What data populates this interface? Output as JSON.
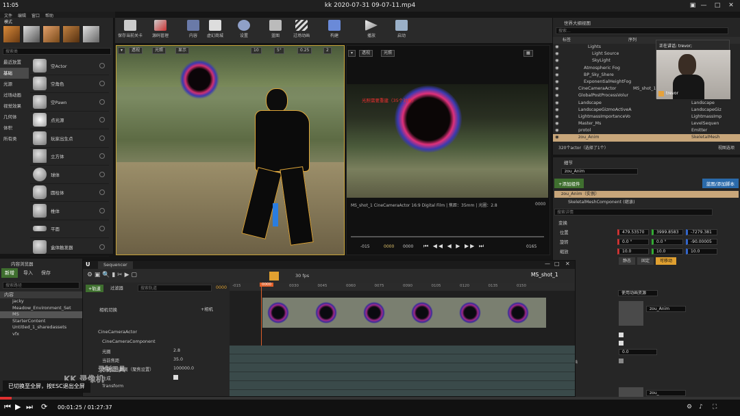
{
  "player": {
    "clock": "11:05",
    "video_title": "kk 2020-07-31 09-07-11.mp4",
    "time_current": "00:01:25",
    "time_separator": " / ",
    "time_total": "01:27:37",
    "progress_fraction": 0.016,
    "fullscreen_tip": "已切换至全屏，按ESC退出全屏"
  },
  "menu": [
    "文件",
    "编辑",
    "窗口",
    "帮助"
  ],
  "modes": {
    "title": "模式",
    "search_placeholder": "搜索类",
    "categories": [
      "最近放置",
      "基础",
      "光源",
      "过场动画",
      "视觉效果",
      "几何体",
      "体积",
      "所有类"
    ],
    "active_category": 1,
    "items": [
      "空Actor",
      "空角色",
      "空Pawn",
      "点光源",
      "玩家出生点",
      "立方体",
      "球体",
      "圆柱体",
      "椎体",
      "平面",
      "盒体触发器"
    ]
  },
  "toolbar": {
    "buttons": [
      "保存当前关卡",
      "源码管理",
      "内容",
      "虚幻商城",
      "设置",
      "蓝图",
      "过场动画",
      "构建",
      "播放",
      "启动"
    ]
  },
  "viewport": {
    "view_mode": "透视",
    "lighting": "光照",
    "show": "显示",
    "grid_snap": "10",
    "angle_snap": "5°",
    "scale_snap": "0.25",
    "camera_speed": "2"
  },
  "cine": {
    "view_mode": "透视",
    "lighting": "光照",
    "overlay_text": "光照需要重建（35个对象）",
    "info": "MS_shot_1   CineCameraActor   16:9 Digital Film | 焦距：35mm | 光圈：2.8",
    "frame_right": "0000",
    "tc_left": "-015",
    "tc_mid": "0000",
    "tc_mid2": "0000",
    "tc_right": "0165"
  },
  "outliner": {
    "title": "世界大纲视图",
    "search_placeholder": "搜索...",
    "col_label": "标签",
    "col_type": "序列",
    "rows": [
      {
        "label": "Lights",
        "type": ""
      },
      {
        "label": "Light Source",
        "type": ""
      },
      {
        "label": "SkyLight",
        "type": ""
      },
      {
        "label": "Atmospheric Fog",
        "type": ""
      },
      {
        "label": "BP_Sky_Shere",
        "type": ""
      },
      {
        "label": "ExponentialHeightFog",
        "type": ""
      },
      {
        "label": "CineCameraActor",
        "type": "MS_shot_1"
      },
      {
        "label": "GlobalPostProcessVolur",
        "type": ""
      },
      {
        "label": "Landscape",
        "type": "Landscape"
      },
      {
        "label": "LandscapeGizmoActiveA",
        "type": "LandscapeGiz"
      },
      {
        "label": "LightmassImportanceVo",
        "type": "LightmassImp"
      },
      {
        "label": "Master_Ms",
        "type": "LevelSequen"
      },
      {
        "label": "protol",
        "type": "Emitter"
      },
      {
        "label": "zou_Anim",
        "type": "SkeletalMesh"
      }
    ],
    "selected_row": 13,
    "footer": "320个actor（选择了1个）",
    "view_options": "视图选项"
  },
  "webcam": {
    "speaking_label": "正在讲话: trevor;",
    "name": "trevor"
  },
  "details": {
    "title": "细节",
    "actor_name": "zou_Anim",
    "add_component": "+添加组件",
    "blueprint_button": "蓝图/添加脚本",
    "instance_label": "zou_Anim（实例）",
    "component": "SkeletalMeshComponent (继承)",
    "search_placeholder": "搜索详情",
    "transform_header": "变换",
    "location_label": "位置",
    "rotation_label": "旋转",
    "scale_label": "缩放",
    "location": [
      "479.53570",
      "3999.8583",
      "-7279.381"
    ],
    "rotation": [
      "0.0 °",
      "0.0 °",
      "-90.00005"
    ],
    "scale": [
      "10.0",
      "10.0",
      "10.0"
    ],
    "mobility": [
      "静态",
      "固定",
      "可移动"
    ],
    "anim_mode": "使用动画资源",
    "anim_asset": "zou_Anim",
    "anim_asset2": "zou_",
    "value_field": "0.0",
    "side_labels": [
      "画",
      "2置画"
    ]
  },
  "content": {
    "title": "内容浏览器",
    "new_button": "新增",
    "import_button": "导入",
    "save_button": "保存",
    "search_placeholder": "搜索路径",
    "root": "内容",
    "folders": [
      "jacky",
      "Meadow_Environment_Set",
      "MS",
      "StarterContent",
      "Untitled_1_sharedassets",
      "vfx"
    ],
    "selected_folder": 2
  },
  "sequencer": {
    "title": "Sequencer",
    "shot_name": "MS_shot_1",
    "fps": "30 fps",
    "track_button": "+轨道",
    "filter_button": "过滤器",
    "search_placeholder": "搜索轨道",
    "frame_current": "0000",
    "frame_marker": "0000",
    "ruler": [
      "-015",
      "0015",
      "0030",
      "0045",
      "0060",
      "0075",
      "0090",
      "0105",
      "0120",
      "0135",
      "0150"
    ],
    "camera_cuts": "相机切换",
    "camera_add": "+相机",
    "cine_actor": "CineCameraActor",
    "cine_component": "CineCameraComponent",
    "props": [
      {
        "label": "光圈",
        "value": "2.8"
      },
      {
        "label": "当前焦距",
        "value": "35.0"
      },
      {
        "label": "手动聚焦距离（聚焦设置）",
        "value": "100000.0"
      },
      {
        "label": "生成",
        "value": ""
      },
      {
        "label": "Transform",
        "value": ""
      }
    ],
    "watermark_line1": "录制工具",
    "watermark_line2": "KK 录像机"
  }
}
